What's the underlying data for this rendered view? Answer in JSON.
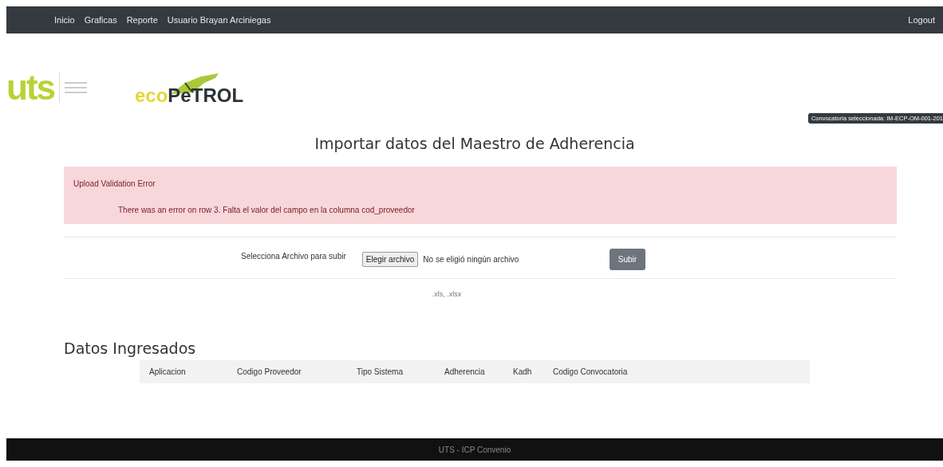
{
  "navbar": {
    "links": [
      "Inicio",
      "Graficas",
      "Reporte",
      "Usuario Brayan Arciniegas"
    ],
    "logout": "Logout"
  },
  "logos": [
    {
      "kind": "uts",
      "parts": [
        "uts"
      ]
    },
    {
      "kind": "ecopetrol",
      "parts": [
        "eco",
        "PeTROL"
      ]
    }
  ],
  "badge": "Convocatoria seleccionada: IM-ECP-OM-001-201",
  "title": "Importar datos del Maestro de Adherencia",
  "alert": {
    "heading": "Upload Validation Error",
    "message": "There was an error on row 3. Falta el valor del campo en la columna cod_proveedor"
  },
  "upload": {
    "label": "Selecciona Archivo para subir",
    "choose_button": "Elegir archivo",
    "file_status": "No se eligió ningún archivo",
    "submit": "Subir",
    "hint": ".xls, .xlsx"
  },
  "section_title": "Datos Ingresados",
  "table": {
    "columns": [
      "Aplicacion",
      "Codigo Proveedor",
      "Tipo Sistema",
      "Adherencia",
      "Kadh",
      "Codigo Convocatoria"
    ]
  },
  "footer": "UTS - ICP Convenio"
}
